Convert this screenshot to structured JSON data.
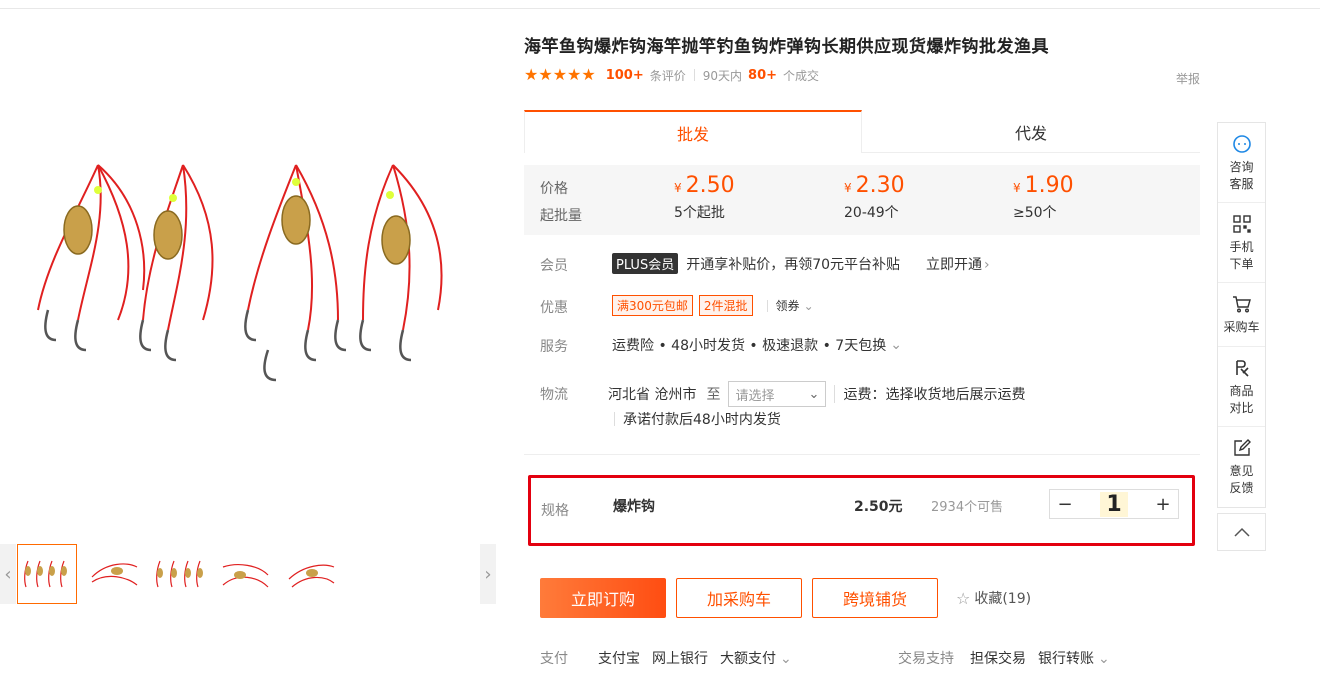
{
  "product": {
    "title": "海竿鱼钩爆炸钩海竿抛竿钓鱼钩炸弹钩长期供应现货爆炸钩批发渔具",
    "reviews_count": "100+",
    "reviews_label": "条评价",
    "sales_period": "90天内",
    "sales_count": "80+",
    "sales_label": "个成交",
    "report_label": "举报",
    "rating_stars": 5
  },
  "gallery": {
    "prev_label": "‹",
    "next_label": "›"
  },
  "tabs": [
    {
      "label": "批发",
      "active": true
    },
    {
      "label": "代发",
      "active": false
    }
  ],
  "price_box": {
    "price_label": "价格",
    "moq_label": "起批量",
    "currency": "¥",
    "tiers": [
      {
        "price": "2.50",
        "qty": "5个起批"
      },
      {
        "price": "2.30",
        "qty": "20-49个"
      },
      {
        "price": "1.90",
        "qty": "≥50个"
      }
    ]
  },
  "member": {
    "label": "会员",
    "badge": "PLUS会员",
    "text": "开通享补贴价，再领70元平台补贴",
    "link": "立即开通"
  },
  "promo": {
    "label": "优惠",
    "tags": [
      "满300元包邮",
      "2件混批"
    ],
    "coupon": "领券"
  },
  "service": {
    "label": "服务",
    "text": "运费险 • 48小时发货 • 极速退款 • 7天包换"
  },
  "logistics": {
    "label": "物流",
    "from": "河北省 沧州市",
    "to_label": "至",
    "select_placeholder": "请选择",
    "fee_text": "运费：选择收货地后展示运费",
    "promise": "承诺付款后48小时内发货"
  },
  "spec": {
    "label": "规格",
    "name": "爆炸钩",
    "price": "2.50元",
    "stock": "2934个可售",
    "quantity": "1",
    "minus": "−",
    "plus": "+"
  },
  "actions": {
    "buy": "立即订购",
    "cart": "加采购车",
    "cross": "跨境铺货",
    "favorite": "收藏(19)"
  },
  "payment": {
    "label": "支付",
    "methods": [
      "支付宝",
      "网上银行",
      "大额支付"
    ],
    "trade_label": "交易支持",
    "trade_methods": [
      "担保交易",
      "银行转账"
    ]
  },
  "sidebar": {
    "items": [
      {
        "label": "咨询客服",
        "icon": "chat-icon"
      },
      {
        "label": "手机下单",
        "icon": "qrcode-icon"
      },
      {
        "label": "采购车",
        "icon": "cart-icon"
      },
      {
        "label": "商品对比",
        "icon": "compare-icon"
      },
      {
        "label": "意见反馈",
        "icon": "feedback-icon"
      }
    ]
  },
  "colors": {
    "accent": "#ff5000",
    "highlight_border": "#e3000f",
    "star": "#ff7300"
  }
}
